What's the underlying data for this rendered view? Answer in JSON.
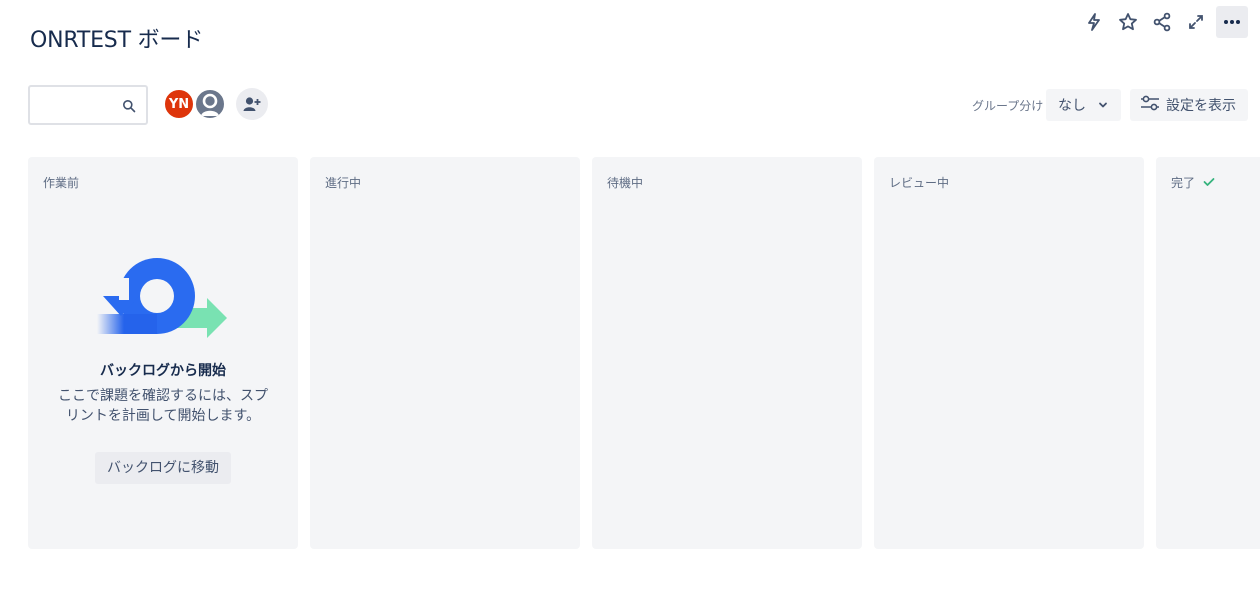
{
  "page": {
    "title": "ONRTEST ボード"
  },
  "toolbar": {
    "search_placeholder": "",
    "avatars": [
      {
        "initials": "YN",
        "color": "#de350b"
      }
    ],
    "group_by_label": "グループ分け",
    "group_by_value": "なし",
    "settings_label": "設定を表示"
  },
  "columns": [
    {
      "title": "作業前",
      "empty_state": {
        "title": "バックログから開始",
        "description": "ここで課題を確認するには、スプリントを計画して開始します。",
        "button_label": "バックログに移動"
      }
    },
    {
      "title": "進行中"
    },
    {
      "title": "待機中"
    },
    {
      "title": "レビュー中"
    },
    {
      "title": "完了",
      "done": true
    }
  ],
  "colors": {
    "accent": "#2563eb",
    "done_check": "#36b37e",
    "column_bg": "#f4f5f7"
  }
}
